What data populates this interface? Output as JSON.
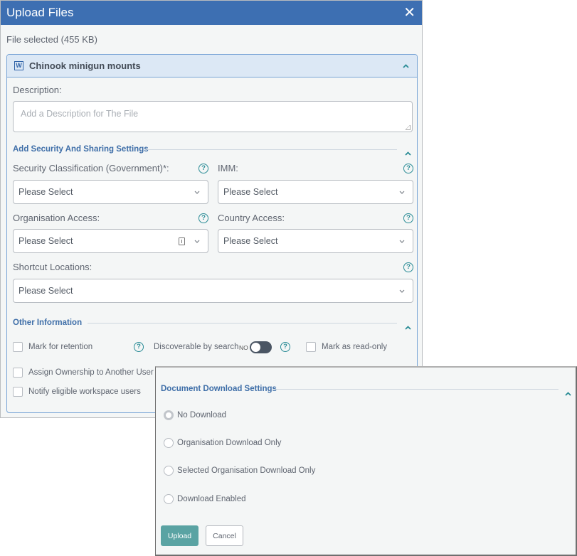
{
  "dialog": {
    "title": "Upload Files",
    "close_icon": "close-icon",
    "file_selected_text": "File selected (455 KB)"
  },
  "file": {
    "name": "Chinook minigun mounts",
    "type_icon": "word-document-icon",
    "type_icon_glyph": "W",
    "description_label": "Description:",
    "description_value": "",
    "description_placeholder": "Add a Description for The File"
  },
  "security": {
    "section_title": "Add Security And Sharing Settings",
    "fields": {
      "classification": {
        "label": "Security Classification (Government)*:",
        "value": "Please Select"
      },
      "imm": {
        "label": "IMM:",
        "value": "Please Select"
      },
      "organisation_access": {
        "label": "Organisation Access:",
        "value": "Please Select"
      },
      "country_access": {
        "label": "Country Access:",
        "value": "Please Select"
      },
      "shortcut_locations": {
        "label": "Shortcut Locations:",
        "value": "Please Select"
      }
    },
    "help_glyph": "?"
  },
  "other": {
    "section_title": "Other Information",
    "mark_for_retention": {
      "label": "Mark for retention",
      "checked": false
    },
    "discoverable": {
      "label": "Discoverable by search",
      "state_label": "NO",
      "on": false
    },
    "mark_read_only": {
      "label": "Mark as read-only",
      "checked": false
    },
    "assign_ownership": {
      "label": "Assign Ownership to Another User",
      "checked": false
    },
    "notify_users": {
      "label": "Notify eligible workspace users",
      "checked": false
    }
  },
  "download": {
    "section_title": "Document Download Settings",
    "options": [
      {
        "label": "No Download",
        "selected": true
      },
      {
        "label": "Organisation Download Only",
        "selected": false
      },
      {
        "label": "Selected Organisation Download Only",
        "selected": false
      },
      {
        "label": "Download Enabled",
        "selected": false
      }
    ],
    "upload_label": "Upload",
    "cancel_label": "Cancel"
  },
  "colors": {
    "title_bar": "#3d6fb2",
    "accent_teal": "#2a8c96",
    "upload_button": "#5aa3a3",
    "section_title": "#3e6ea8"
  }
}
